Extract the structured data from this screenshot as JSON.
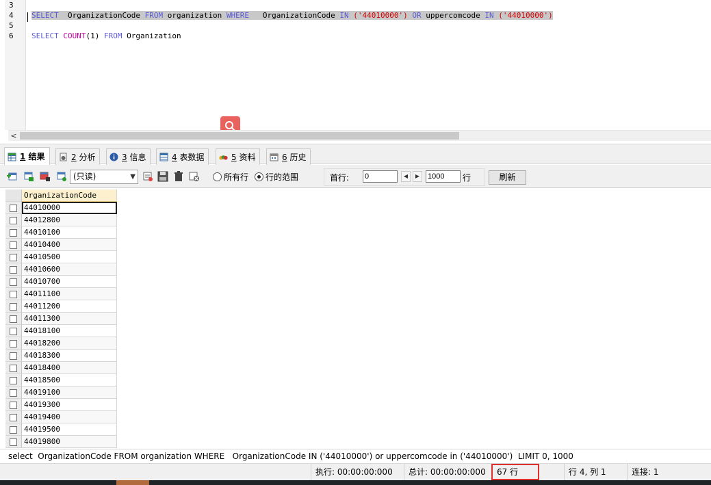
{
  "editor": {
    "line_numbers": [
      "3",
      "4",
      "5",
      "6"
    ],
    "query_line": {
      "kw_select": "SELECT",
      "col": "OrganizationCode",
      "kw_from": "FROM",
      "table": "organization",
      "kw_where": "WHERE",
      "col2": "OrganizationCode",
      "kw_in": "IN",
      "val1": "('44010000')",
      "kw_or": "OR",
      "col3": "uppercomcode",
      "kw_in2": "IN",
      "val2": "('44010000')"
    },
    "count_line": {
      "kw_select": "SELECT",
      "fn_count": "COUNT",
      "arg": "(1)",
      "kw_from": "FROM",
      "table": "Organization"
    }
  },
  "tabs": [
    {
      "num": "1",
      "label": "结果",
      "icon": "grid-icon"
    },
    {
      "num": "2",
      "label": "分析",
      "icon": "profile-icon"
    },
    {
      "num": "3",
      "label": "信息",
      "icon": "info-icon"
    },
    {
      "num": "4",
      "label": "表数据",
      "icon": "table-icon"
    },
    {
      "num": "5",
      "label": "资料",
      "icon": "chart-icon"
    },
    {
      "num": "6",
      "label": "历史",
      "icon": "calendar-icon"
    }
  ],
  "toolbar": {
    "mode": "(只读)",
    "radio_all": "所有行",
    "radio_range": "行的范围",
    "first_row_label": "首行:",
    "first_row_value": "0",
    "row_count_value": "1000",
    "row_unit": "行",
    "refresh": "刷新"
  },
  "grid": {
    "column": "OrganizationCode",
    "rows": [
      "44010000",
      "44012800",
      "44010100",
      "44010400",
      "44010500",
      "44010600",
      "44010700",
      "44011100",
      "44011200",
      "44011300",
      "44018100",
      "44018200",
      "44018300",
      "44018400",
      "44018500",
      "44019100",
      "44019300",
      "44019400",
      "44019500",
      "44019800"
    ]
  },
  "status": {
    "sql": "select  OrganizationCode FROM organization WHERE   OrganizationCode IN ('44010000') or uppercomcode in ('44010000')  LIMIT 0, 1000",
    "exec": "执行: 00:00:00:000",
    "total": "总计: 00:00:00:000",
    "rows": "67 行",
    "position": "行 4, 列 1",
    "connection": "连接: 1"
  },
  "colors": {
    "keyword": "#5a5ad6",
    "string": "#d40000",
    "function": "#c800a0",
    "highlight_box": "#e0302b",
    "search_button": "#e9625d"
  }
}
